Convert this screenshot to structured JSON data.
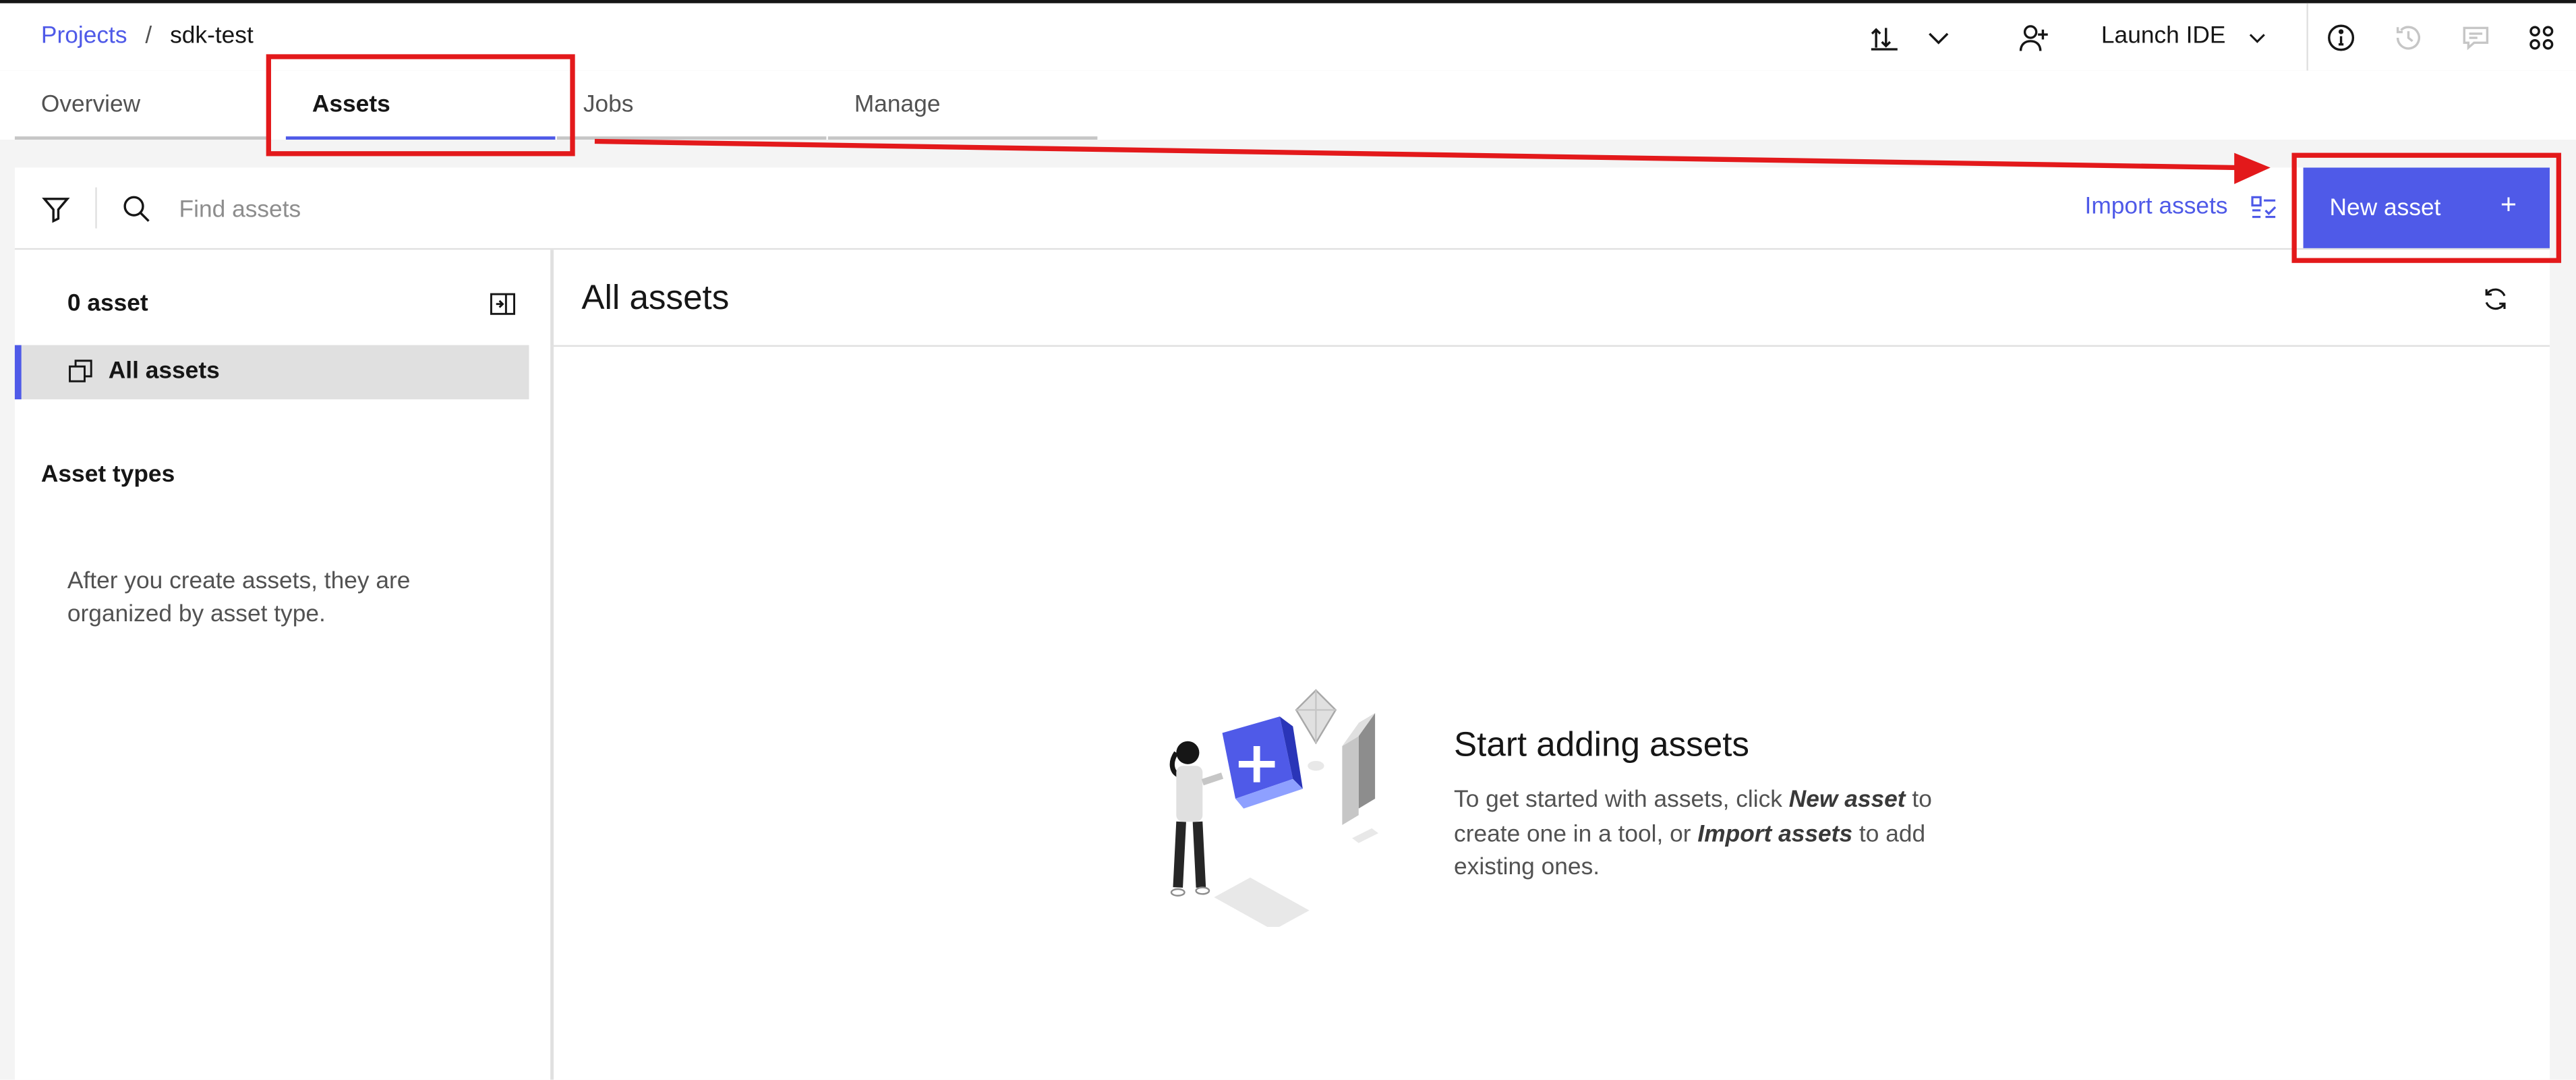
{
  "breadcrumb": {
    "projects": "Projects",
    "separator": "/",
    "current": "sdk-test"
  },
  "header": {
    "launch_ide": "Launch IDE",
    "icons": [
      "upload-download-icon",
      "chevron-down-icon",
      "add-collaborator-icon",
      "info-icon",
      "history-icon",
      "comment-icon",
      "apps-icon"
    ]
  },
  "tabs": [
    {
      "label": "Overview",
      "active": false
    },
    {
      "label": "Assets",
      "active": true
    },
    {
      "label": "Jobs",
      "active": false
    },
    {
      "label": "Manage",
      "active": false
    }
  ],
  "toolbar": {
    "search_placeholder": "Find assets",
    "import_label": "Import assets",
    "new_asset_label": "New asset",
    "new_asset_plus": "+"
  },
  "sidebar": {
    "count": "0 asset",
    "all_assets": "All assets",
    "asset_types_heading": "Asset types",
    "hint": "After you create assets, they are organized by asset type."
  },
  "main": {
    "title": "All assets",
    "empty_title": "Start adding assets",
    "empty_desc": {
      "part1": "To get started with assets, click ",
      "new_asset": "New asset",
      "part2": " to create one in a tool, or ",
      "import_assets": "Import assets",
      "part3": " to add existing ones."
    }
  },
  "colors": {
    "accent": "#4f5ae8",
    "annotation": "#e3191b",
    "panel_bg": "#f4f4f4"
  }
}
